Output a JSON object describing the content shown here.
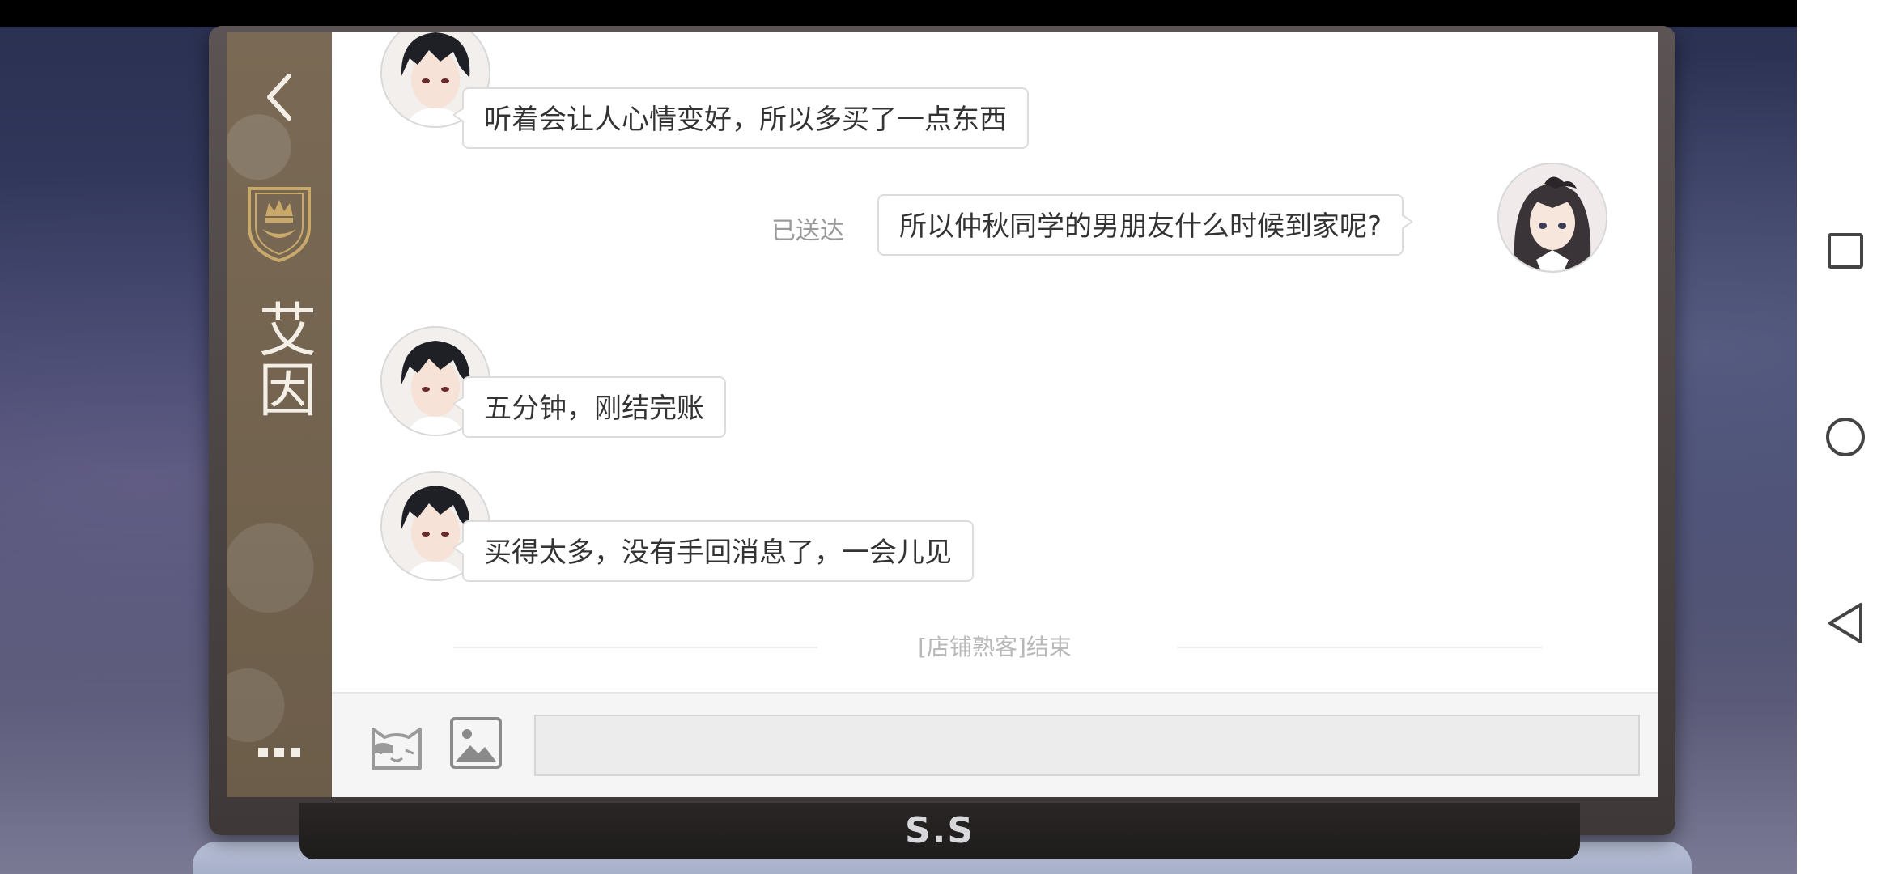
{
  "contact": {
    "name": "艾因"
  },
  "messages": [
    {
      "sender": "contact",
      "text": "听着会让人心情变好，所以多买了一点东西"
    },
    {
      "sender": "self",
      "text": "所以仲秋同学的男朋友什么时候到家呢?",
      "status": "已送达"
    },
    {
      "sender": "contact",
      "text": "五分钟，刚结完账"
    },
    {
      "sender": "contact",
      "text": "买得太多，没有手回消息了，一会儿见"
    }
  ],
  "chat_end_label": "[店铺熟客]结束",
  "input": {
    "value": "",
    "placeholder": ""
  },
  "device_brand": "S.S",
  "icons": {
    "back": "chevron-left-icon",
    "crest": "crown-crest-icon",
    "menu": "more-dots-icon",
    "sticker": "cat-sticker-icon",
    "image": "image-icon",
    "nav_recent": "square-recents-icon",
    "nav_home": "circle-home-icon",
    "nav_back": "triangle-back-icon"
  },
  "colors": {
    "sidebar": "#6c5d4a",
    "bubble_border": "#dcdcdc",
    "status_text": "#9a9a9a"
  }
}
